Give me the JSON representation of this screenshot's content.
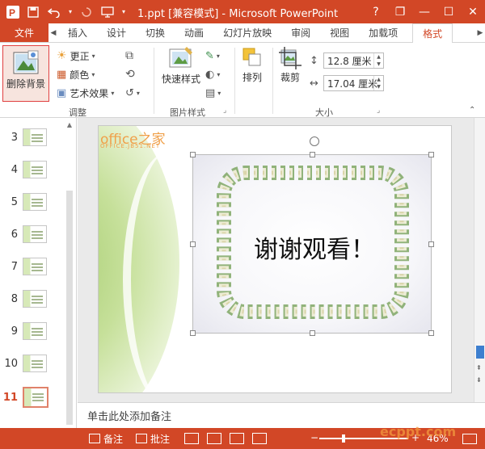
{
  "titlebar": {
    "title": "1.ppt [兼容模式] - Microsoft PowerPoint",
    "help": "?",
    "restore": "❐",
    "minimize": "—",
    "maximize": "☐",
    "close": "✕"
  },
  "tabs": {
    "file": "文件",
    "items": [
      "插入",
      "设计",
      "切换",
      "动画",
      "幻灯片放映",
      "审阅",
      "视图",
      "加载项"
    ],
    "active": "格式"
  },
  "ribbon": {
    "remove_background": "删除背景",
    "corrections": "更正",
    "color": "颜色",
    "artistic_effects": "艺术效果",
    "group_adjust": "调整",
    "quick_styles": "快速样式",
    "group_picture_styles": "图片样式",
    "arrange": "排列",
    "crop": "裁剪",
    "height_value": "12.8 厘米",
    "width_value": "17.04 厘米",
    "group_size": "大小"
  },
  "slides": {
    "numbers": [
      "3",
      "4",
      "5",
      "6",
      "7",
      "8",
      "9",
      "10",
      "11"
    ],
    "active": "11"
  },
  "slide": {
    "watermark_main": "office之家",
    "watermark_sub": "OFFICE.JB51.NET",
    "text": "谢谢观看！"
  },
  "notes": {
    "placeholder": "单击此处添加备注"
  },
  "statusbar": {
    "notes": "备注",
    "comments": "批注",
    "zoom_text": "46%"
  },
  "watermark_bottom": "ecppt.com",
  "colors": {
    "accent": "#d24726"
  }
}
